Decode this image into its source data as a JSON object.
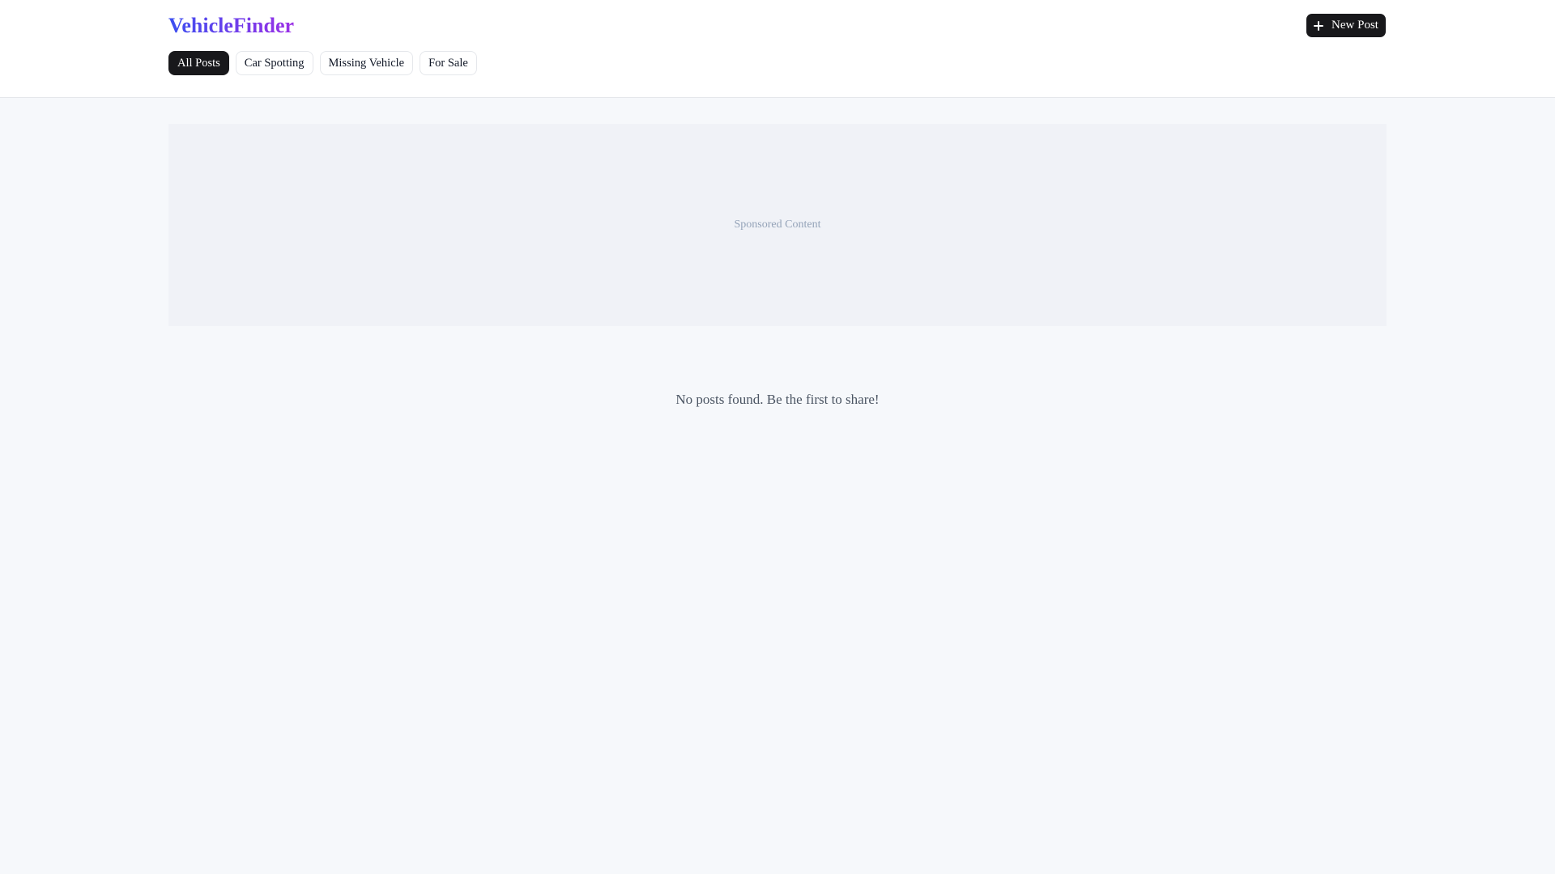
{
  "header": {
    "logo": "VehicleFinder",
    "new_post_label": "New Post",
    "new_post_icon": "plus-icon"
  },
  "filters": [
    {
      "label": "All Posts",
      "active": true
    },
    {
      "label": "Car Spotting",
      "active": false
    },
    {
      "label": "Missing Vehicle",
      "active": false
    },
    {
      "label": "For Sale",
      "active": false
    }
  ],
  "sponsored": {
    "label": "Sponsored Content"
  },
  "main": {
    "empty_message": "No posts found. Be the first to share!"
  },
  "colors": {
    "logo_gradient_start": "#3b4ff0",
    "logo_gradient_end": "#9b2fe6",
    "primary_button": "#18181b",
    "page_background": "#f6f8fb"
  }
}
